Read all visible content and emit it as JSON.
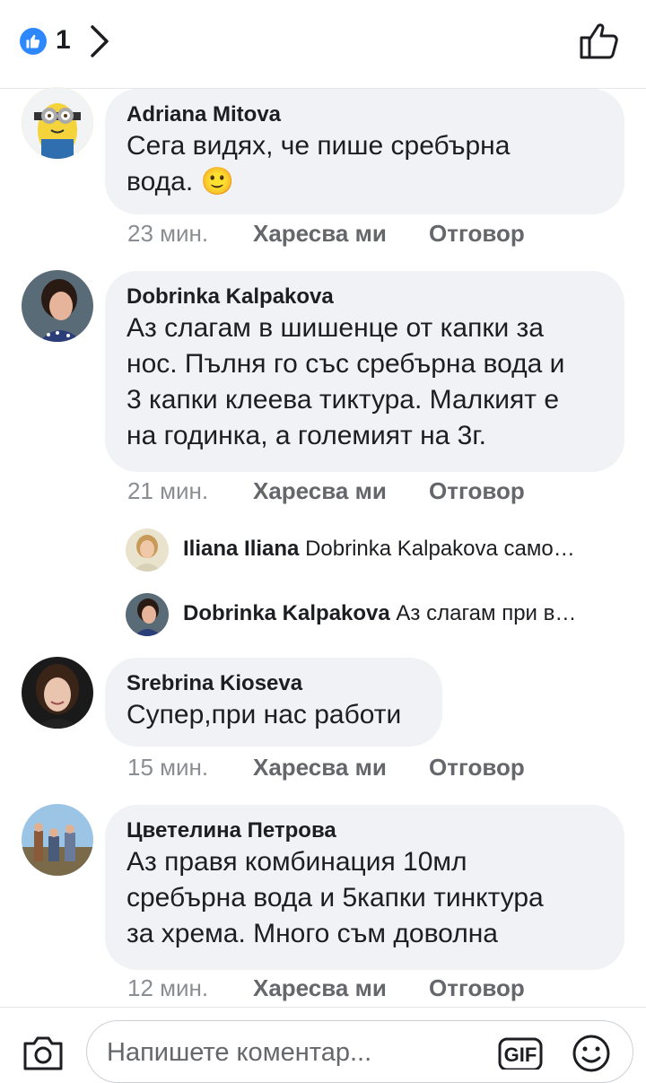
{
  "header": {
    "like_count": "1",
    "like_badge_icon": "thumbs-up-icon",
    "chevron_icon": "chevron-right-icon",
    "like_button_icon": "thumbs-up-outline-icon",
    "accent_color": "#2d88ff"
  },
  "comments": [
    {
      "author": "Adriana Mitova",
      "text": "Сега видях, че пише сребърна\nвода. ",
      "emoji": "🙂",
      "time": "23 мин.",
      "like_label": "Харесва ми",
      "reply_label": "Отговор"
    },
    {
      "author": "Dobrinka Kalpakova",
      "text": "Аз слагам в шишенце от капки за\nнос. Пълня го със сребърна вода и\n3 капки клеева тиктура. Малкият е\nна годинка, а големият на 3г.",
      "time": "21 мин.",
      "like_label": "Харесва ми",
      "reply_label": "Отговор"
    },
    {
      "author": "Srebrina Kioseva",
      "text": "Супер,при нас работи",
      "time": "15 мин.",
      "like_label": "Харесва ми",
      "reply_label": "Отговор"
    },
    {
      "author": "Цветелина Петрова",
      "text": "Аз правя комбинация 10мл\nсребърна вода и 5капки тинктура\nза хрема. Много съм доволна",
      "time": "12 мин.",
      "like_label": "Харесва ми",
      "reply_label": "Отговор"
    }
  ],
  "replies": [
    {
      "author": "Iliana Iliana",
      "preview": "Dobrinka Kalpakova само…"
    },
    {
      "author": "Dobrinka Kalpakova",
      "preview": "Аз слагам при в…"
    }
  ],
  "composer": {
    "placeholder": "Напишете коментар...",
    "camera_icon": "camera-icon",
    "gif_label": "GIF",
    "emoji_icon": "smiley-icon"
  }
}
